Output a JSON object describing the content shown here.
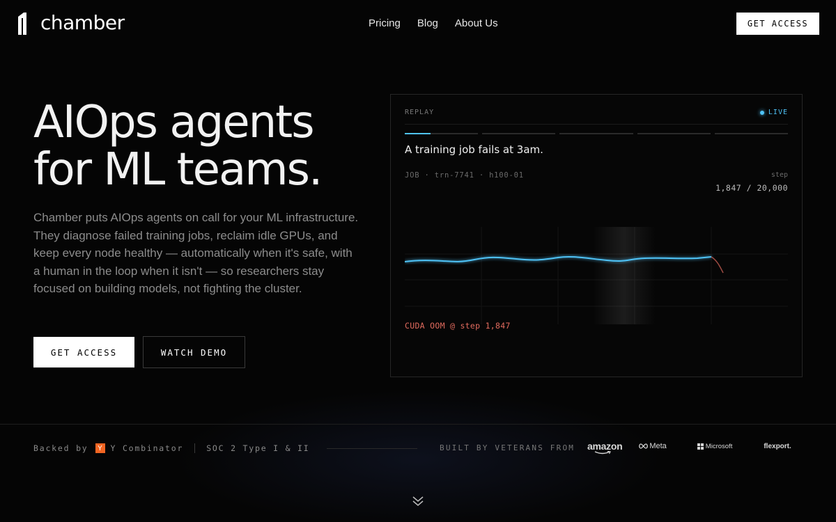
{
  "header": {
    "logo_text": "chamber",
    "nav": [
      "Pricing",
      "Blog",
      "About Us"
    ],
    "cta_label": "GET ACCESS"
  },
  "hero": {
    "title_line1": "AIOps agents",
    "title_line2": "for ML teams.",
    "subtitle": "Chamber puts AIOps agents on call for your ML infrastructure. They diagnose failed training jobs, reclaim idle GPUs, and keep every node healthy — automatically when it's safe, with a human in the loop when it isn't — so researchers stay focused on building models, not fighting the cluster.",
    "primary_cta": "GET ACCESS",
    "secondary_cta": "WATCH DEMO"
  },
  "panel": {
    "replay_label": "REPLAY",
    "live_label": "LIVE",
    "progress": [
      0.35,
      0,
      0,
      0,
      0
    ],
    "heading": "A training job fails at 3am.",
    "job_line": "JOB · trn-7741 · h100-01",
    "step_label": "step",
    "step_value": "1,847 / 20,000",
    "error_text": "CUDA OOM @ step 1,847",
    "accent_color": "#4fc3f7",
    "error_color": "#e06a5d"
  },
  "footer": {
    "backed_by": "Backed by",
    "yc_letter": "Y",
    "yc_name": "Y Combinator",
    "soc": "SOC 2 Type I & II",
    "built_by": "BUILT BY VETERANS FROM",
    "companies": [
      "amazon",
      "Meta",
      "Microsoft",
      "flexport."
    ]
  },
  "icons": {
    "logo": "chamber-logo-icon",
    "scroll": "chevron-double-down-icon"
  }
}
